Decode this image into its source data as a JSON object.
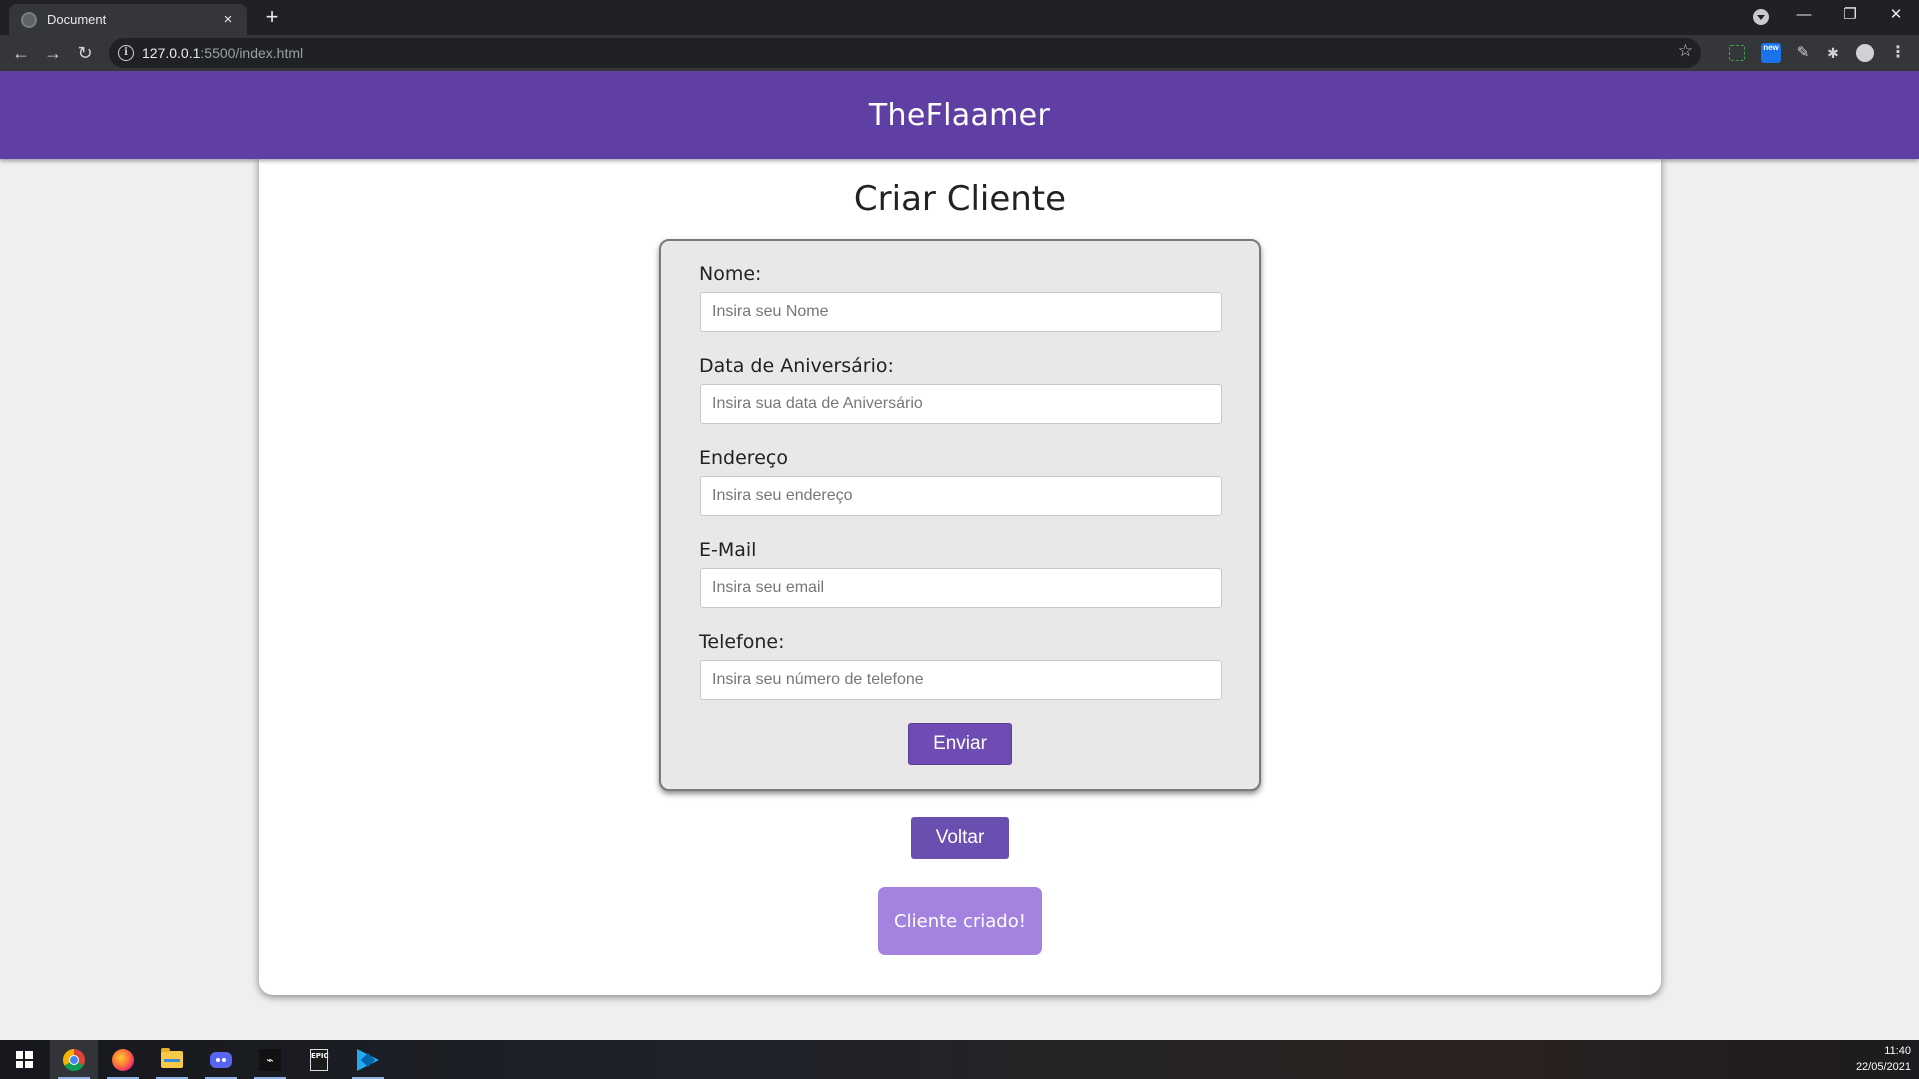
{
  "browser": {
    "tab_title": "Document",
    "tab_close": "×",
    "new_tab": "+",
    "url_host": "127.0.0.1",
    "url_path": ":5500/index.html",
    "back": "←",
    "forward": "→",
    "reload": "↻",
    "info": "i",
    "bookmark": "☆",
    "minimize": "—",
    "restore": "❐",
    "close": "✕",
    "ext_badge": "new",
    "ext_pen": "✎",
    "ext_puzzle": "✱",
    "ext_menu": "⋮"
  },
  "site": {
    "title": "TheFlaamer"
  },
  "card": {
    "title": "Criar Cliente"
  },
  "form": {
    "fields": [
      {
        "label": "Nome:",
        "placeholder": "Insira seu Nome",
        "value": ""
      },
      {
        "label": "Data de Aniversário:",
        "placeholder": "Insira sua data de Aniversário",
        "value": ""
      },
      {
        "label": "Endereço",
        "placeholder": "Insira seu endereço",
        "value": ""
      },
      {
        "label": "E-Mail",
        "placeholder": "Insira seu email",
        "value": ""
      },
      {
        "label": "Telefone:",
        "placeholder": "Insira seu número de telefone",
        "value": ""
      }
    ],
    "submit_label": "Enviar"
  },
  "back_label": "Voltar",
  "status_message": "Cliente criado!",
  "taskbar": {
    "time": "11:40",
    "date": "22/05/2021",
    "hyperx_glyph": "⌁",
    "epic_text": "EPIC"
  },
  "colors": {
    "header": "#5f3fa3",
    "submit": "#6f4bb4",
    "back": "#6a4fb1",
    "status": "#a383df"
  }
}
